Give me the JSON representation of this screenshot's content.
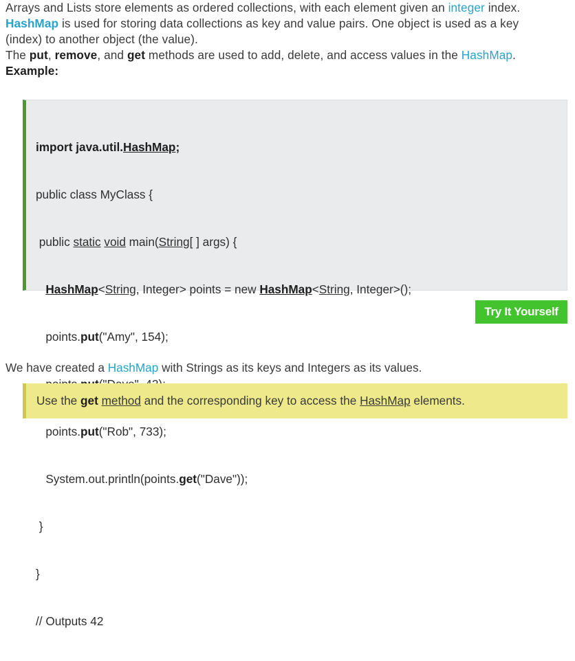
{
  "intro": {
    "p1_a": "Arrays and Lists store elements as ordered collections, with each element given an ",
    "p1_link": "integer",
    "p1_b": " index.",
    "p2_hashmap": "HashMap",
    "p2_rest": " is used for storing data collections as key and value pairs. One object is used as a key",
    "p2_line2": "(index) to another object (the value).",
    "p3_a": "The ",
    "p3_put": "put",
    "p3_comma": ", ",
    "p3_remove": "remove",
    "p3_and": ", and ",
    "p3_get": "get",
    "p3_b": " methods are used to add, delete, and access values in the ",
    "p3_hashmap": "HashMap",
    "p3_end": ".",
    "example_label": "Example:"
  },
  "code": {
    "l1_a": "import java.util.",
    "l1_b": "HashMap",
    "l1_c": ";",
    "l2": "public class MyClass {",
    "l3_a": " public ",
    "l3_static": "static",
    "l3_sp": " ",
    "l3_void": "void",
    "l3_b": " main(",
    "l3_string": "String",
    "l3_c": "[ ] args) {",
    "l4_indent": "   ",
    "l4_hm1": "HashMap",
    "l4_a": "<",
    "l4_str1": "String",
    "l4_b": ", Integer> points = new ",
    "l4_hm2": "HashMap",
    "l4_c": "<",
    "l4_str2": "String",
    "l4_d": ", Integer>();",
    "l5_a": "   points.",
    "l5_put": "put",
    "l5_b": "(\"Amy\", 154);",
    "l6_a": "   points.",
    "l6_put": "put",
    "l6_b": "(\"Dave\", 42);",
    "l7_a": "   points.",
    "l7_put": "put",
    "l7_b": "(\"Rob\", 733);",
    "l8_a": "   System.out.println(points.",
    "l8_get": "get",
    "l8_b": "(\"Dave\"));",
    "l9": " }",
    "l10": "}",
    "l11": "// Outputs 42"
  },
  "try_button": "Try It Yourself",
  "summary": {
    "a": "We have created a ",
    "hashmap": "HashMap",
    "b": " with Strings as its keys and Integers as its values."
  },
  "tip": {
    "a": "Use the ",
    "get": "get",
    "sp": " ",
    "method": "method",
    "b": " and the corresponding key to access the ",
    "hashmap": "HashMap",
    "c": " elements."
  },
  "colors": {
    "accent": "#28a4c9",
    "code_bar": "#4d9a2a",
    "button": "#43c42f",
    "tip_bg": "#eeea8c"
  }
}
